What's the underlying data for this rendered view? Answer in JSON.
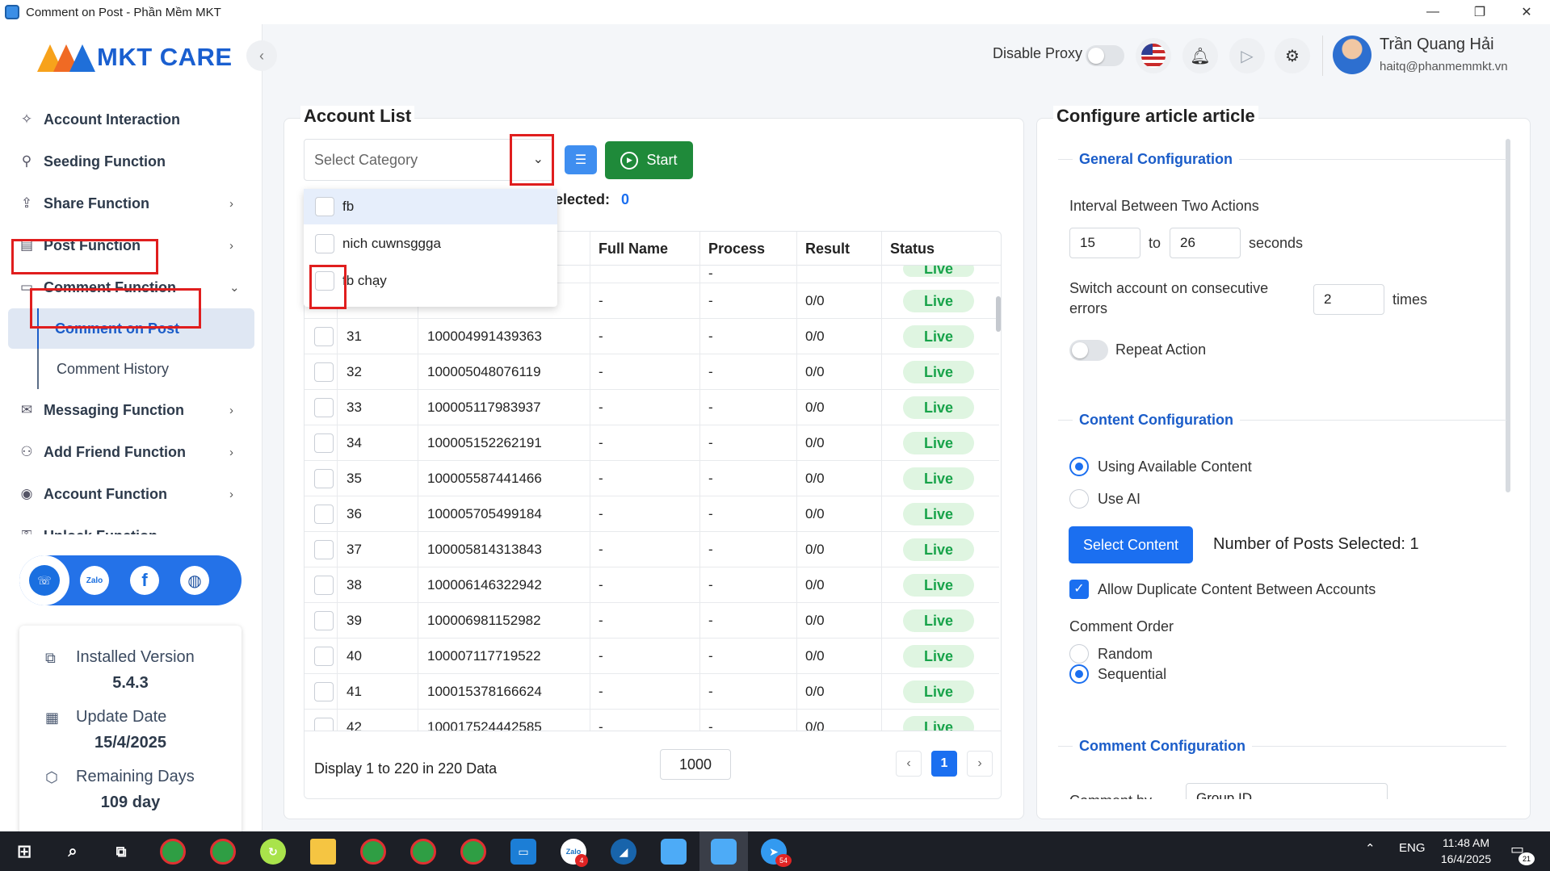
{
  "window": {
    "title": "Comment on Post - Phần Mềm MKT",
    "controls": [
      "—",
      "❐",
      "✕"
    ]
  },
  "logo": {
    "text": "MKT CARE"
  },
  "sidebar": {
    "items": [
      {
        "label": "Account Interaction",
        "icon": "sparkle-icon"
      },
      {
        "label": "Seeding Function",
        "icon": "seed-icon"
      },
      {
        "label": "Share Function",
        "icon": "share-icon",
        "expandable": true
      },
      {
        "label": "Post Function",
        "icon": "post-icon",
        "expandable": true
      },
      {
        "label": "Comment Function",
        "icon": "comment-icon",
        "expandable": true,
        "expanded": true
      },
      {
        "label": "Messaging Function",
        "icon": "message-icon",
        "expandable": true
      },
      {
        "label": "Add Friend Function",
        "icon": "add-friend-icon",
        "expandable": true
      },
      {
        "label": "Account Function",
        "icon": "account-icon",
        "expandable": true
      },
      {
        "label": "Unlock Function",
        "icon": "unlock-icon",
        "expandable": true
      }
    ],
    "sub_items": [
      {
        "label": "Comment on Post",
        "active": true
      },
      {
        "label": "Comment History",
        "active": false
      }
    ],
    "social": [
      "support-icon",
      "Zalo",
      "f",
      "globe-icon"
    ],
    "info": {
      "installed_label": "Installed Version",
      "installed_value": "5.4.3",
      "update_label": "Update Date",
      "update_value": "15/4/2025",
      "remaining_label": "Remaining Days",
      "remaining_value": "109 day"
    }
  },
  "header": {
    "disable_proxy_label": "Disable Proxy",
    "user_name": "Trần Quang Hải",
    "user_email": "haitq@phanmemmkt.vn"
  },
  "account_list": {
    "title": "Account List",
    "category_placeholder": "Select Category",
    "start_label": "Start",
    "selected_label": "elected:",
    "selected_value": "0",
    "columns": [
      "Full Name",
      "Process",
      "Result",
      "Status"
    ],
    "dropdown_options": [
      "fb",
      "nich cuwnsggga",
      "fb chạy"
    ],
    "rows": [
      {
        "no": "",
        "uid": "",
        "name": "-",
        "process": "-",
        "result": "0/0",
        "status": "Live"
      },
      {
        "no": "31",
        "uid": "100004991439363",
        "name": "-",
        "process": "-",
        "result": "0/0",
        "status": "Live"
      },
      {
        "no": "32",
        "uid": "100005048076119",
        "name": "-",
        "process": "-",
        "result": "0/0",
        "status": "Live"
      },
      {
        "no": "33",
        "uid": "100005117983937",
        "name": "-",
        "process": "-",
        "result": "0/0",
        "status": "Live"
      },
      {
        "no": "34",
        "uid": "100005152262191",
        "name": "-",
        "process": "-",
        "result": "0/0",
        "status": "Live"
      },
      {
        "no": "35",
        "uid": "100005587441466",
        "name": "-",
        "process": "-",
        "result": "0/0",
        "status": "Live"
      },
      {
        "no": "36",
        "uid": "100005705499184",
        "name": "-",
        "process": "-",
        "result": "0/0",
        "status": "Live"
      },
      {
        "no": "37",
        "uid": "100005814313843",
        "name": "-",
        "process": "-",
        "result": "0/0",
        "status": "Live"
      },
      {
        "no": "38",
        "uid": "100006146322942",
        "name": "-",
        "process": "-",
        "result": "0/0",
        "status": "Live"
      },
      {
        "no": "39",
        "uid": "100006981152982",
        "name": "-",
        "process": "-",
        "result": "0/0",
        "status": "Live"
      },
      {
        "no": "40",
        "uid": "100007117719522",
        "name": "-",
        "process": "-",
        "result": "0/0",
        "status": "Live"
      },
      {
        "no": "41",
        "uid": "100015378166624",
        "name": "-",
        "process": "-",
        "result": "0/0",
        "status": "Live"
      },
      {
        "no": "42",
        "uid": "100017524442585",
        "name": "-",
        "process": "-",
        "result": "0/0",
        "status": "Live"
      }
    ],
    "footer_text": "Display 1 to 220 in 220 Data",
    "page_size": "1000",
    "current_page": "1",
    "prev": "‹",
    "next": "›"
  },
  "config": {
    "title": "Configure article article",
    "general_title": "General Configuration",
    "interval_label": "Interval Between Two Actions",
    "interval_from": "15",
    "interval_to_label": "to",
    "interval_to": "26",
    "interval_unit": "seconds",
    "switch_label_1": "Switch account on consecutive",
    "switch_label_2": "errors",
    "switch_value": "2",
    "switch_unit": "times",
    "repeat_label": "Repeat Action",
    "content_title": "Content Configuration",
    "opt_available": "Using Available Content",
    "opt_ai": "Use AI",
    "select_content_label": "Select Content",
    "posts_selected": "Number of Posts Selected: 1",
    "allow_duplicate": "Allow Duplicate Content Between Accounts",
    "order_label": "Comment Order",
    "order_random": "Random",
    "order_sequential": "Sequential",
    "comment_config_title": "Comment Configuration",
    "comment_by_label": "Comment by",
    "comment_by_value": "Group ID"
  },
  "taskbar": {
    "lang": "ENG",
    "time": "11:48 AM",
    "date": "16/4/2025",
    "notif_count": "21",
    "badges": [
      "4",
      "54"
    ]
  }
}
